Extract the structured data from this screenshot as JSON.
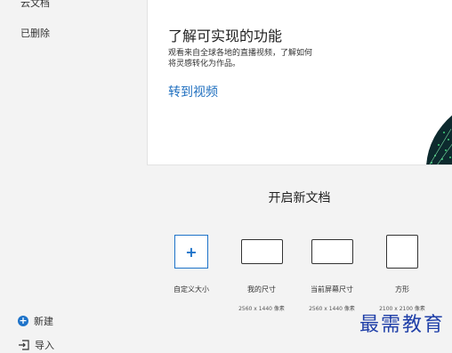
{
  "sidebar": {
    "nav_items": [
      {
        "label": "云文档"
      },
      {
        "label": "已删除"
      }
    ],
    "new_label": "新建",
    "import_label": "导入"
  },
  "promo_card": {
    "title": "了解可实现的功能",
    "description": "观看来自全球各地的直播视频，了解如何将灵感转化为作品。",
    "link_label": "转到视频"
  },
  "new_document": {
    "heading": "开启新文档",
    "presets": [
      {
        "label": "自定义大小",
        "size": "",
        "icon": "plus-icon"
      },
      {
        "label": "我的尺寸",
        "size": "2560 x 1440 像素",
        "icon": "landscape-rect-icon"
      },
      {
        "label": "当前屏幕尺寸",
        "size": "2560 x 1440 像素",
        "icon": "landscape-rect-icon"
      },
      {
        "label": "方形",
        "size": "2100 x 2100 像素",
        "icon": "square-icon"
      }
    ]
  },
  "watermark": "最需教育",
  "colors": {
    "accent": "#1e73c9",
    "link": "#1f6fbf",
    "background": "#f3f3f3",
    "card": "#ffffff",
    "watermark": "#1f3fa8"
  }
}
